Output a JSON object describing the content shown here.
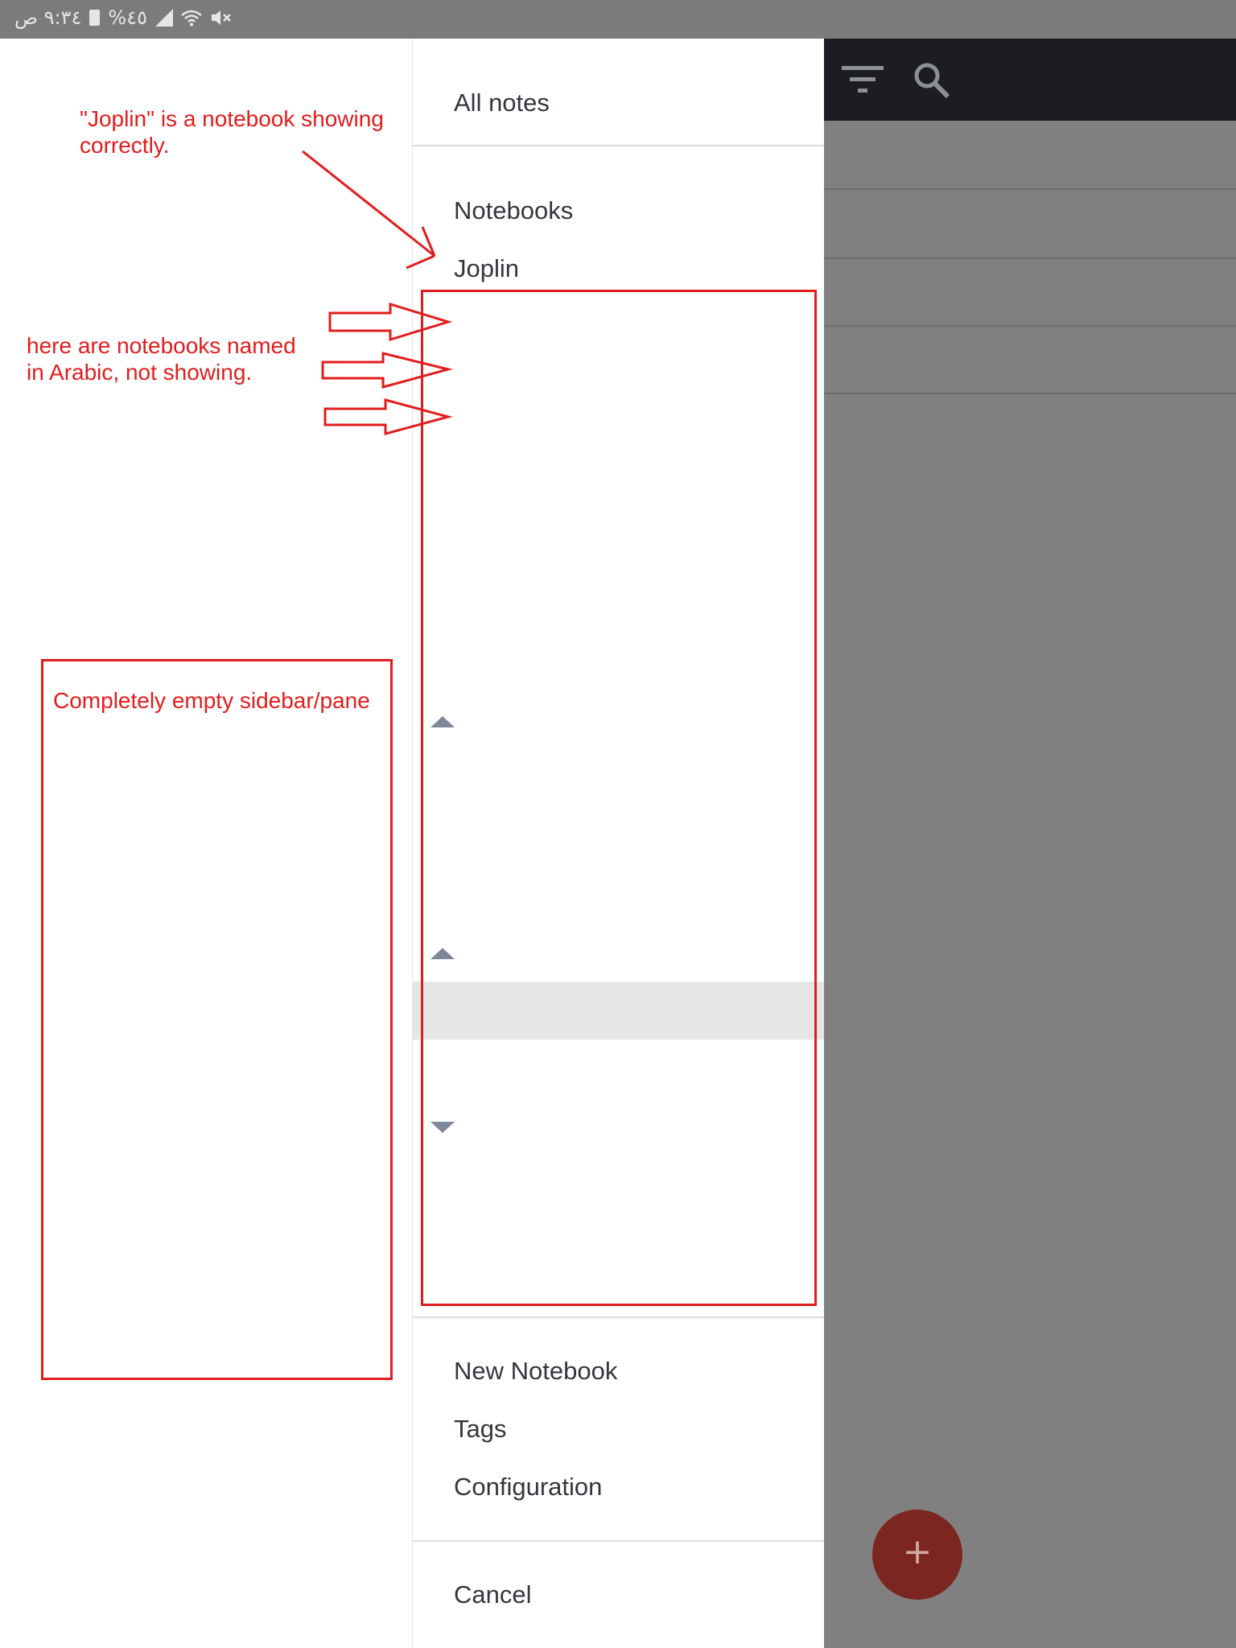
{
  "status_bar": {
    "time": "٩:٣٤ ص",
    "battery": "%٤٥",
    "icons": [
      "battery-icon",
      "signal-icon",
      "wifi-icon",
      "mute-icon"
    ]
  },
  "toolbar": {
    "icons": [
      "filter-icon",
      "search-icon"
    ]
  },
  "drawer": {
    "all_notes": "All notes",
    "notebooks_header": "Notebooks",
    "notebooks": [
      {
        "label": "Joplin"
      }
    ],
    "new_notebook": "New Notebook",
    "tags": "Tags",
    "configuration": "Configuration",
    "cancel": "Cancel"
  },
  "fab": {
    "label": "+"
  },
  "annotations": {
    "joplin_note": "\"Joplin\" is a notebook showing correctly.",
    "arabic_note": "here are notebooks named in Arabic, not showing.",
    "empty_pane_note": "Completely empty sidebar/pane"
  },
  "colors": {
    "annotation": "#e21d1d",
    "toolbar": "#1b1d22",
    "overlay": "#808080",
    "fab": "#7b2620",
    "chevron": "#7e8898"
  }
}
